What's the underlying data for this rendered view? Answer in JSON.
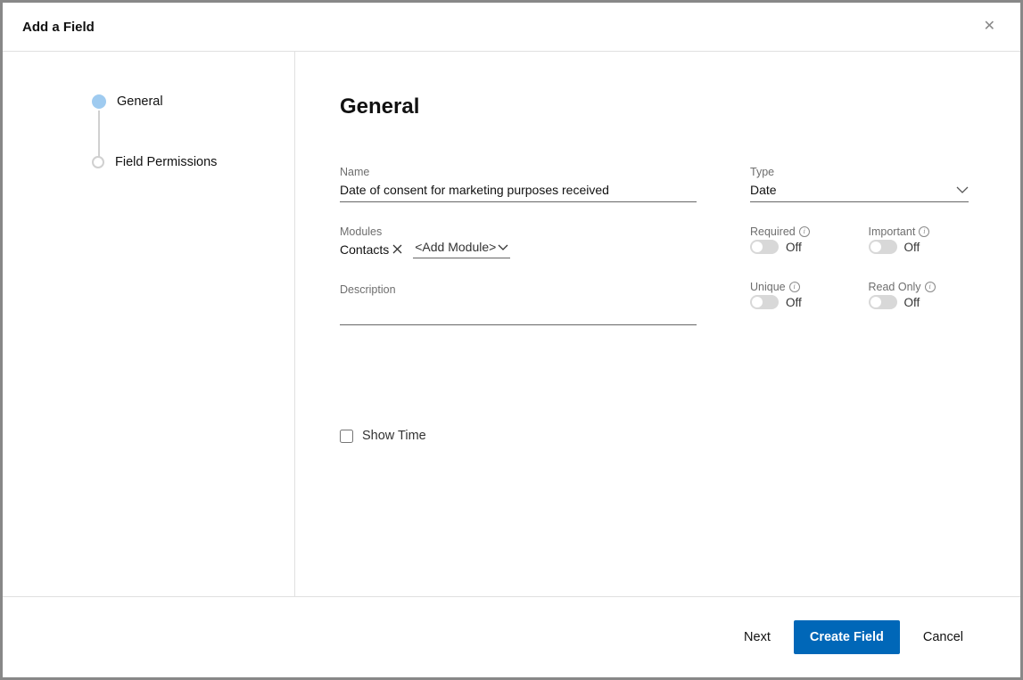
{
  "dialog": {
    "title": "Add a Field",
    "steps": [
      {
        "label": "General",
        "active": true
      },
      {
        "label": "Field Permissions",
        "active": false
      }
    ]
  },
  "section": {
    "title": "General"
  },
  "form": {
    "name_label": "Name",
    "name_value": "Date of consent for marketing purposes received",
    "type_label": "Type",
    "type_value": "Date",
    "modules_label": "Modules",
    "modules": [
      {
        "name": "Contacts"
      }
    ],
    "add_module_label": "<Add Module>",
    "description_label": "Description",
    "description_value": "",
    "show_time_label": "Show Time",
    "show_time_checked": false
  },
  "toggles": {
    "required": {
      "label": "Required",
      "state": "Off"
    },
    "important": {
      "label": "Important",
      "state": "Off"
    },
    "unique": {
      "label": "Unique",
      "state": "Off"
    },
    "read_only": {
      "label": "Read Only",
      "state": "Off"
    }
  },
  "footer": {
    "next": "Next",
    "create": "Create Field",
    "cancel": "Cancel"
  }
}
